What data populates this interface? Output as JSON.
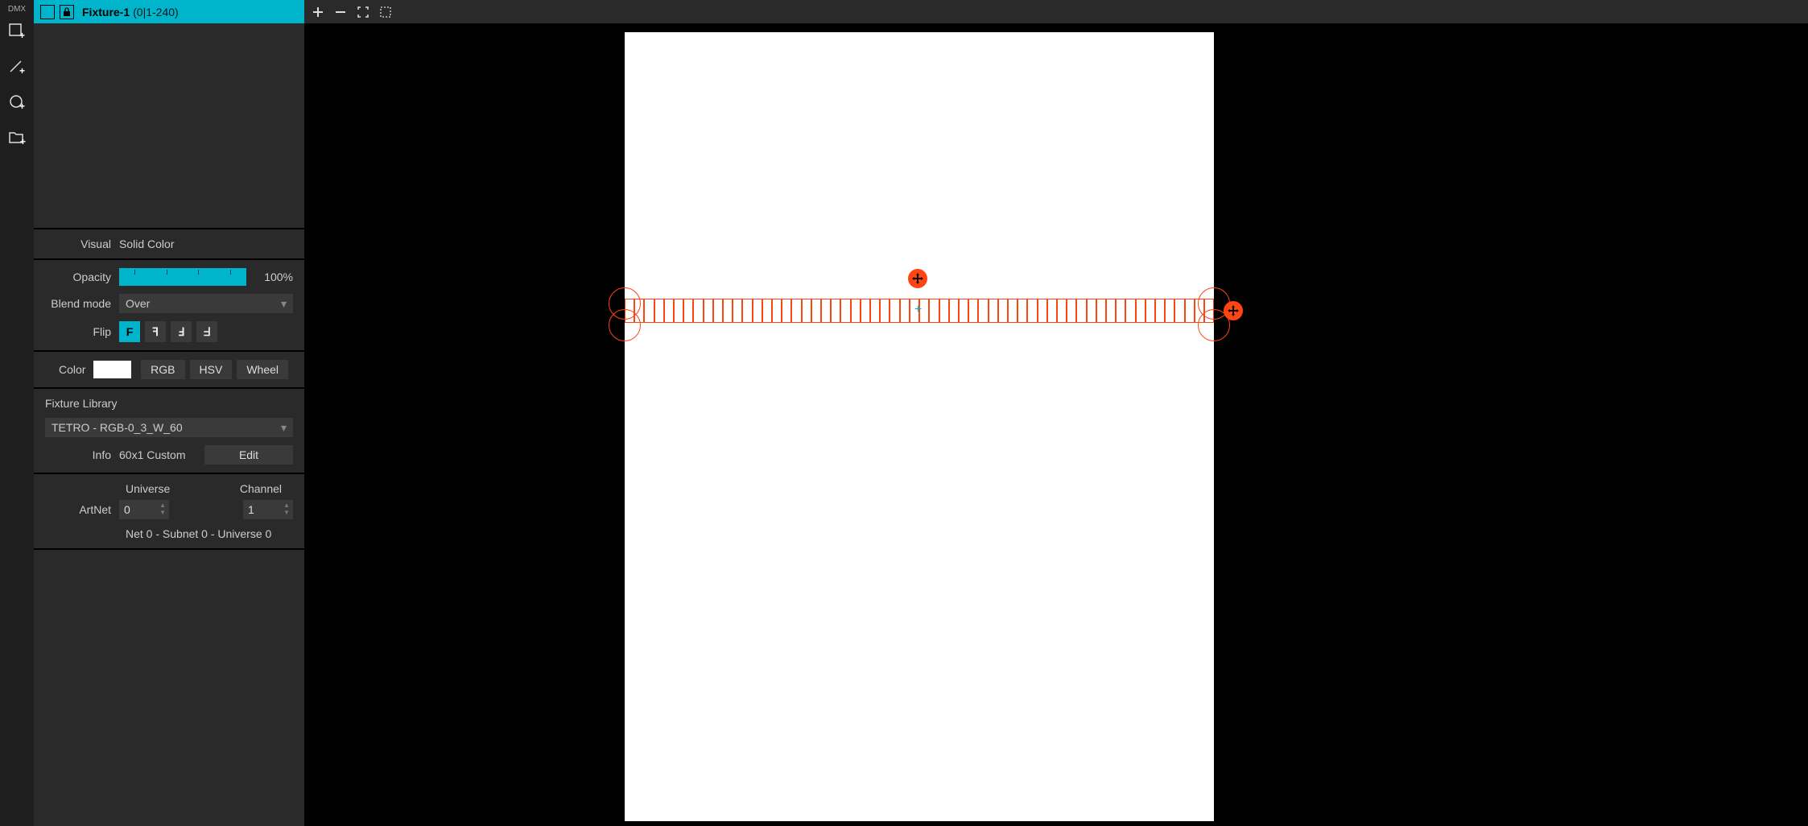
{
  "header": {
    "dmx_label": "DMX",
    "title": "Fixture-1",
    "sub": "(0|1-240)"
  },
  "visual": {
    "label": "Visual",
    "value": "Solid Color"
  },
  "opacity": {
    "label": "Opacity",
    "value": "100%"
  },
  "blend": {
    "label": "Blend mode",
    "value": "Over"
  },
  "flip": {
    "label": "Flip",
    "options": [
      "F",
      "ꟻ",
      "Ⅎ",
      "ᖵ"
    ]
  },
  "color": {
    "label": "Color",
    "swatch": "#ffffff",
    "tabs": [
      "RGB",
      "HSV",
      "Wheel"
    ]
  },
  "library": {
    "title": "Fixture Library",
    "value": "TETRO - RGB-0_3_W_60",
    "info_label": "Info",
    "info_value": "60x1 Custom",
    "edit": "Edit"
  },
  "dmx": {
    "universe_label": "Universe",
    "channel_label": "Channel",
    "artnet_label": "ArtNet",
    "universe": "0",
    "channel": "1",
    "netline": "Net 0 - Subnet 0 - Universe 0"
  },
  "fixture": {
    "cell_count": 60
  }
}
